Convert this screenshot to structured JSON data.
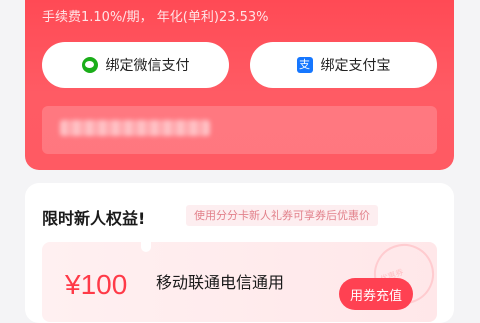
{
  "top_card": {
    "fee_text": "手续费1.10%/期， 年化(单利)23.53%",
    "bind_wechat_label": "绑定微信支付",
    "bind_alipay_label": "绑定支付宝",
    "icons": {
      "wechat": "wechat-pay-icon",
      "alipay": "alipay-icon"
    },
    "colors": {
      "accent": "#ff4a55"
    }
  },
  "benefits": {
    "title": "限时新人权益!",
    "tip": "使用分分卡新人礼券可享券后优惠价",
    "coupon": {
      "amount": "¥100",
      "description": "移动联通电信通用",
      "button_label": "用券充值",
      "stamp_text": "优惠券"
    }
  }
}
